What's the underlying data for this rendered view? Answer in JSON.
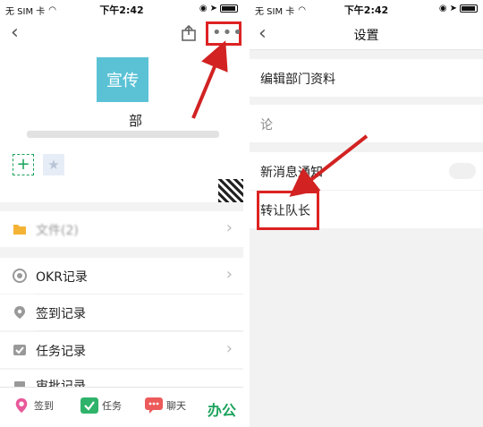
{
  "status": {
    "carrier": "无 SIM 卡",
    "time": "下午2:42"
  },
  "left": {
    "dept_avatar_text": "宣传",
    "dept_name_fragment": "部",
    "rows": [
      {
        "label": "文件(2)"
      },
      {
        "label": "OKR记录"
      },
      {
        "label": "签到记录"
      },
      {
        "label": "任务记录"
      },
      {
        "label": "审批记录"
      }
    ],
    "tabs": {
      "checkin": "签到",
      "task": "任务",
      "chat": "聊天",
      "office": "办公"
    }
  },
  "right": {
    "title": "设置",
    "items": [
      {
        "label": "编辑部门资料"
      },
      {
        "label": "论"
      },
      {
        "label": "新消息通知"
      },
      {
        "label": "转让队长"
      }
    ]
  },
  "colors": {
    "accent_green": "#1aa25a",
    "avatar_teal": "#5bc2d6",
    "annotation_red": "#d22222"
  },
  "icons": {
    "back": "chevron-left-icon",
    "share": "share-icon",
    "more": "more-dots-icon",
    "add": "plus-icon",
    "star": "star-icon",
    "file": "folder-icon",
    "okr": "target-icon",
    "checkin": "location-pin-icon",
    "task": "checkbox-icon",
    "approval": "document-icon",
    "chat": "chat-bubble-icon"
  }
}
